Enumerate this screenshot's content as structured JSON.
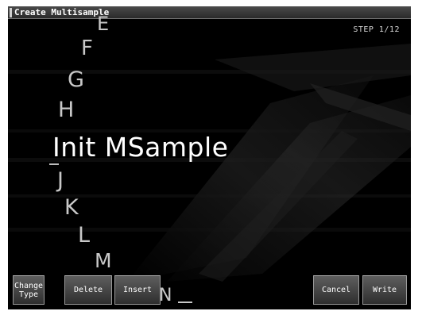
{
  "window": {
    "title": "Create Multisample",
    "step": "STEP 1/12"
  },
  "wheel": {
    "items": [
      "E",
      "F",
      "G",
      "H",
      "Init MSample",
      "J",
      "K",
      "L",
      "M",
      "N"
    ],
    "current": "Init MSample"
  },
  "softkeys": {
    "change_type": "Change\nType",
    "delete": "Delete",
    "insert": "Insert",
    "cancel": "Cancel",
    "write": "Write"
  },
  "colors": {
    "screen_background": "#000000",
    "title_bar": "#3a3a3a",
    "text": "#ffffff",
    "button": "#4a4a4a"
  }
}
